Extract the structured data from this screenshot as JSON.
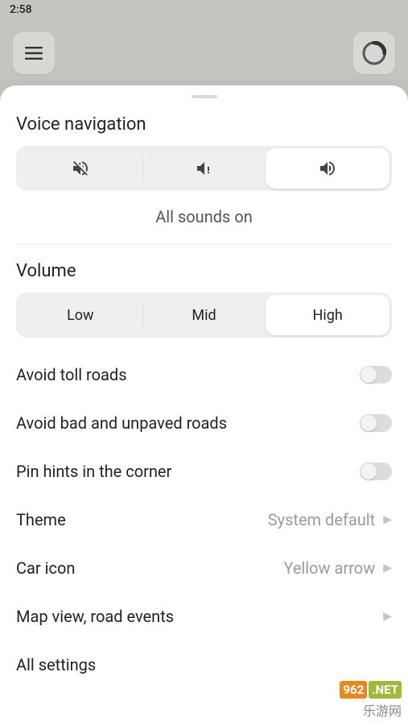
{
  "status": {
    "time": "2:58"
  },
  "sheet": {
    "voice_nav_title": "Voice navigation",
    "voice_options": [
      "mute",
      "alerts",
      "all"
    ],
    "voice_selected_caption": "All sounds on",
    "volume_title": "Volume",
    "volume_options": {
      "low": "Low",
      "mid": "Mid",
      "high": "High"
    },
    "toggles": {
      "avoid_toll": {
        "label": "Avoid toll roads",
        "value": false
      },
      "avoid_bad": {
        "label": "Avoid bad and unpaved roads",
        "value": false
      },
      "pin_hints": {
        "label": "Pin hints in the corner",
        "value": false
      }
    },
    "nav": {
      "theme": {
        "label": "Theme",
        "value": "System default"
      },
      "car_icon": {
        "label": "Car icon",
        "value": "Yellow arrow"
      },
      "map_view": {
        "label": "Map view, road events",
        "value": ""
      },
      "all": {
        "label": "All settings",
        "value": ""
      }
    }
  },
  "watermark": {
    "n1": "962",
    "n2": ".NET",
    "cn": "乐游网"
  }
}
